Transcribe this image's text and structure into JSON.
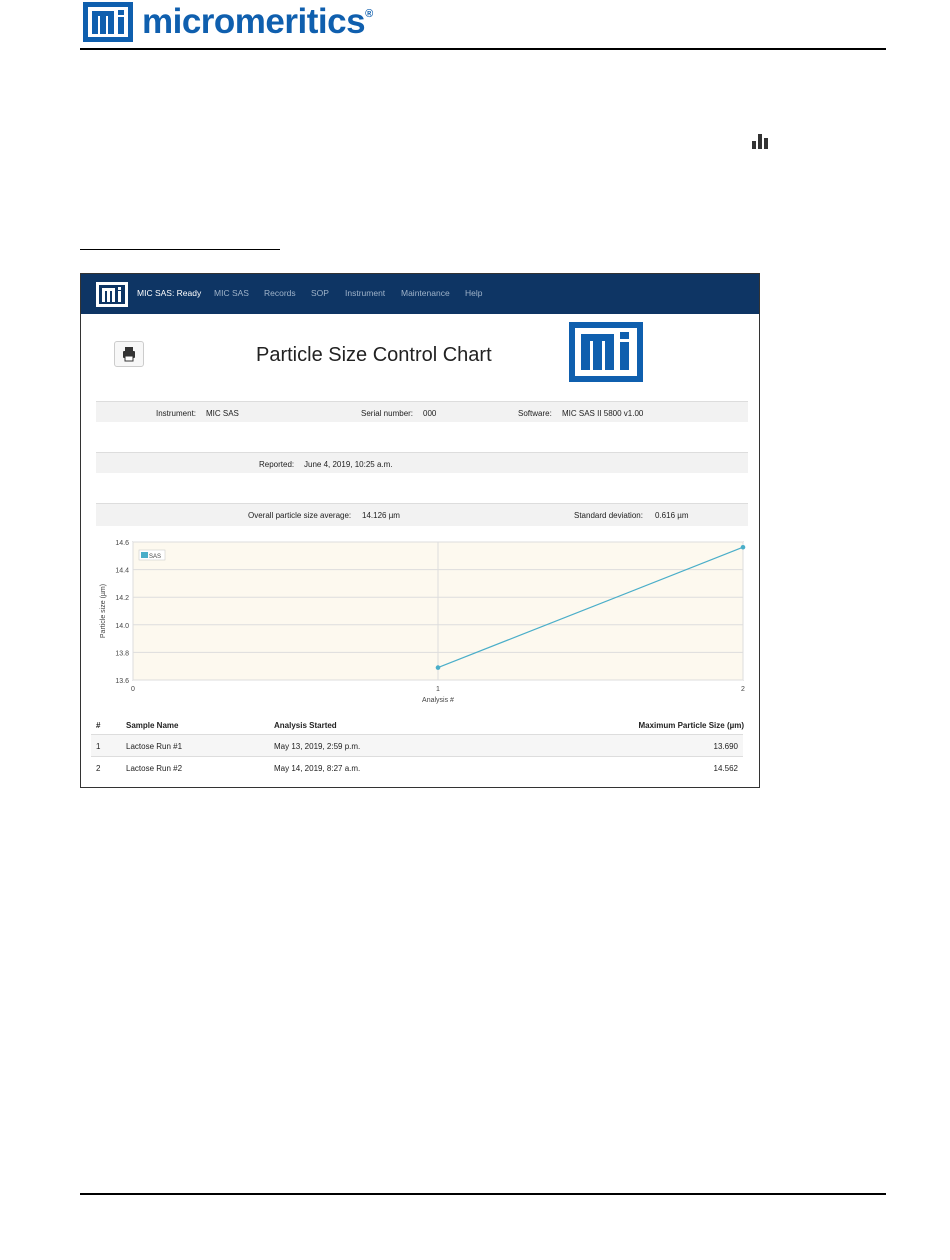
{
  "document": {
    "brand_text": "micromeritics",
    "registered_mark": "®"
  },
  "navbar": {
    "status": "MIC SAS: Ready",
    "items": [
      "MIC SAS",
      "Records",
      "SOP",
      "Instrument",
      "Maintenance",
      "Help"
    ]
  },
  "report": {
    "title": "Particle Size Control Chart",
    "instrument_label": "Instrument:",
    "instrument_value": "MIC SAS",
    "serial_label": "Serial number:",
    "serial_value": "000",
    "software_label": "Software:",
    "software_value": "MIC SAS II 5800 v1.00",
    "reported_label": "Reported:",
    "reported_value": "June 4, 2019, 10:25 a.m.",
    "average_label": "Overall particle size average:",
    "average_value": "14.126 µm",
    "stddev_label": "Standard deviation:",
    "stddev_value": "0.616 µm"
  },
  "chart_data": {
    "type": "line",
    "ylabel": "Particle size (µm)",
    "xlabel": "Analysis #",
    "xlim": [
      0,
      2
    ],
    "ylim": [
      13.6,
      14.6
    ],
    "x_ticks": [
      "0",
      "1",
      "2"
    ],
    "y_ticks": [
      "13.6",
      "13.8",
      "14.0",
      "14.2",
      "14.4",
      "14.6"
    ],
    "grid": true,
    "legend_position": "top-left",
    "series": [
      {
        "name": "SAS",
        "x": [
          1,
          2
        ],
        "values": [
          13.69,
          14.562
        ],
        "color": "#4aaec9"
      }
    ],
    "plot_background": "#fdf9ef"
  },
  "table": {
    "headers": [
      "#",
      "Sample Name",
      "Analysis Started",
      "Maximum Particle Size (µm)"
    ],
    "rows": [
      [
        "1",
        "Lactose Run #1",
        "May 13, 2019, 2:59 p.m.",
        "13.690"
      ],
      [
        "2",
        "Lactose Run #2",
        "May 14, 2019, 8:27 a.m.",
        "14.562"
      ]
    ]
  },
  "colors": {
    "brand_blue": "#0f5fae",
    "navbar": "#0e3564"
  }
}
